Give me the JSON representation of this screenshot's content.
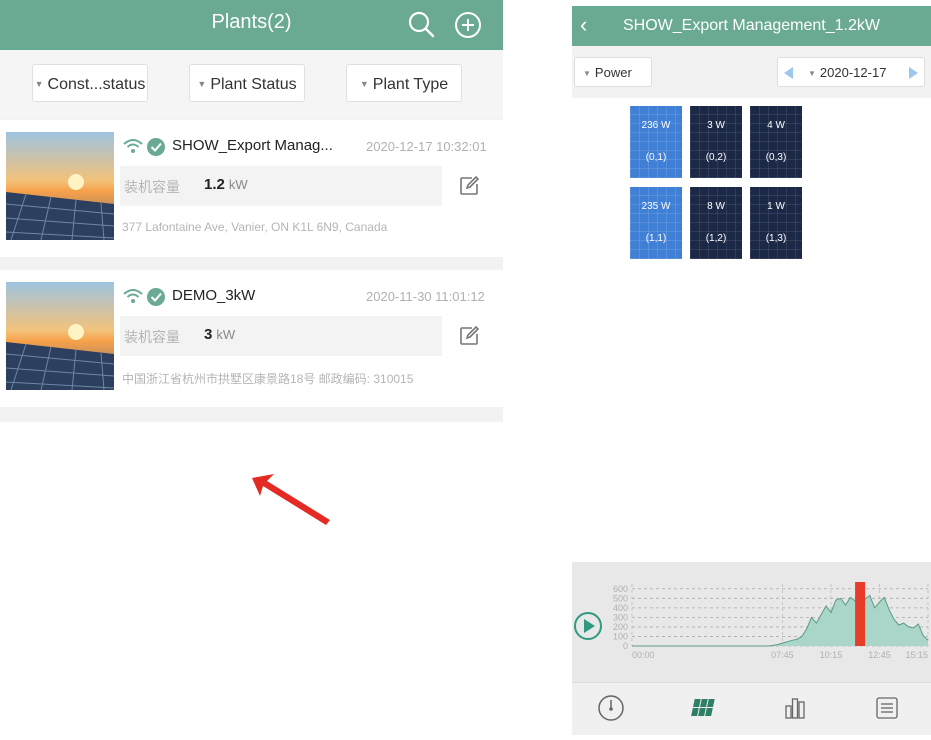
{
  "plants_screen": {
    "title": "Plants(2)",
    "icons": {
      "search": "search-icon",
      "add": "plus-circle-icon"
    },
    "filters": [
      "Const...status",
      "Plant Status",
      "Plant Type"
    ],
    "plants": [
      {
        "name": "SHOW_Export Manag...",
        "time": "2020-12-17 10:32:01",
        "cap_label": "装机容量",
        "cap_value": "1.2",
        "cap_unit": "kW",
        "address": "377 Lafontaine Ave, Vanier, ON K1L 6N9, Canada"
      },
      {
        "name": "DEMO_3kW",
        "time": "2020-11-30 11:01:12",
        "cap_label": "装机容量",
        "cap_value": "3",
        "cap_unit": "kW",
        "address": "中国浙江省杭州市拱墅区康景路18号 邮政编码: 310015"
      }
    ]
  },
  "export_screen": {
    "title": "SHOW_Export Management_1.2kW",
    "metric_select": "Power",
    "date": "2020-12-17",
    "panels": [
      {
        "power": "236 W",
        "pos": "(0,1)",
        "highlight": true
      },
      {
        "power": "3 W",
        "pos": "(0,2)",
        "highlight": false
      },
      {
        "power": "4 W",
        "pos": "(0,3)",
        "highlight": false
      },
      {
        "power": "235 W",
        "pos": "(1,1)",
        "highlight": true
      },
      {
        "power": "8 W",
        "pos": "(1,2)",
        "highlight": false
      },
      {
        "power": "1 W",
        "pos": "(1,3)",
        "highlight": false
      }
    ]
  },
  "chart_data": {
    "type": "area",
    "title": "",
    "xlabel": "",
    "ylabel": "",
    "y_ticks": [
      600,
      500,
      400,
      300,
      200,
      100,
      0
    ],
    "x_ticks": [
      "00:00",
      "07:45",
      "10:15",
      "12:45",
      "15:15"
    ],
    "ylim": [
      0,
      650
    ],
    "x_hours": [
      0,
      1,
      2,
      3,
      4,
      5,
      6,
      7,
      7.25,
      7.5,
      7.75,
      8,
      8.25,
      8.5,
      8.75,
      9,
      9.25,
      9.5,
      9.75,
      10,
      10.25,
      10.5,
      10.75,
      11,
      11.25,
      11.5,
      11.75,
      12,
      12.25,
      12.5,
      12.75,
      13,
      13.25,
      13.5,
      13.75,
      14,
      14.25,
      14.5,
      14.75,
      15,
      15.25
    ],
    "values": [
      0,
      0,
      0,
      0,
      0,
      0,
      0,
      0,
      5,
      15,
      30,
      45,
      60,
      70,
      100,
      180,
      300,
      240,
      330,
      420,
      350,
      480,
      500,
      430,
      510,
      470,
      520,
      490,
      530,
      400,
      460,
      510,
      380,
      280,
      220,
      240,
      200,
      190,
      230,
      110,
      60
    ],
    "marker_time": "11:45",
    "marker_color": "#e83b2a",
    "fill_color": "#a9d6c9",
    "line_color": "#5a9a88",
    "play_icon": "play-icon"
  },
  "bottom_nav": [
    {
      "icon": "gauge-icon"
    },
    {
      "icon": "panel-grid-icon",
      "active": true
    },
    {
      "icon": "bar-chart-icon"
    },
    {
      "icon": "list-icon"
    }
  ]
}
